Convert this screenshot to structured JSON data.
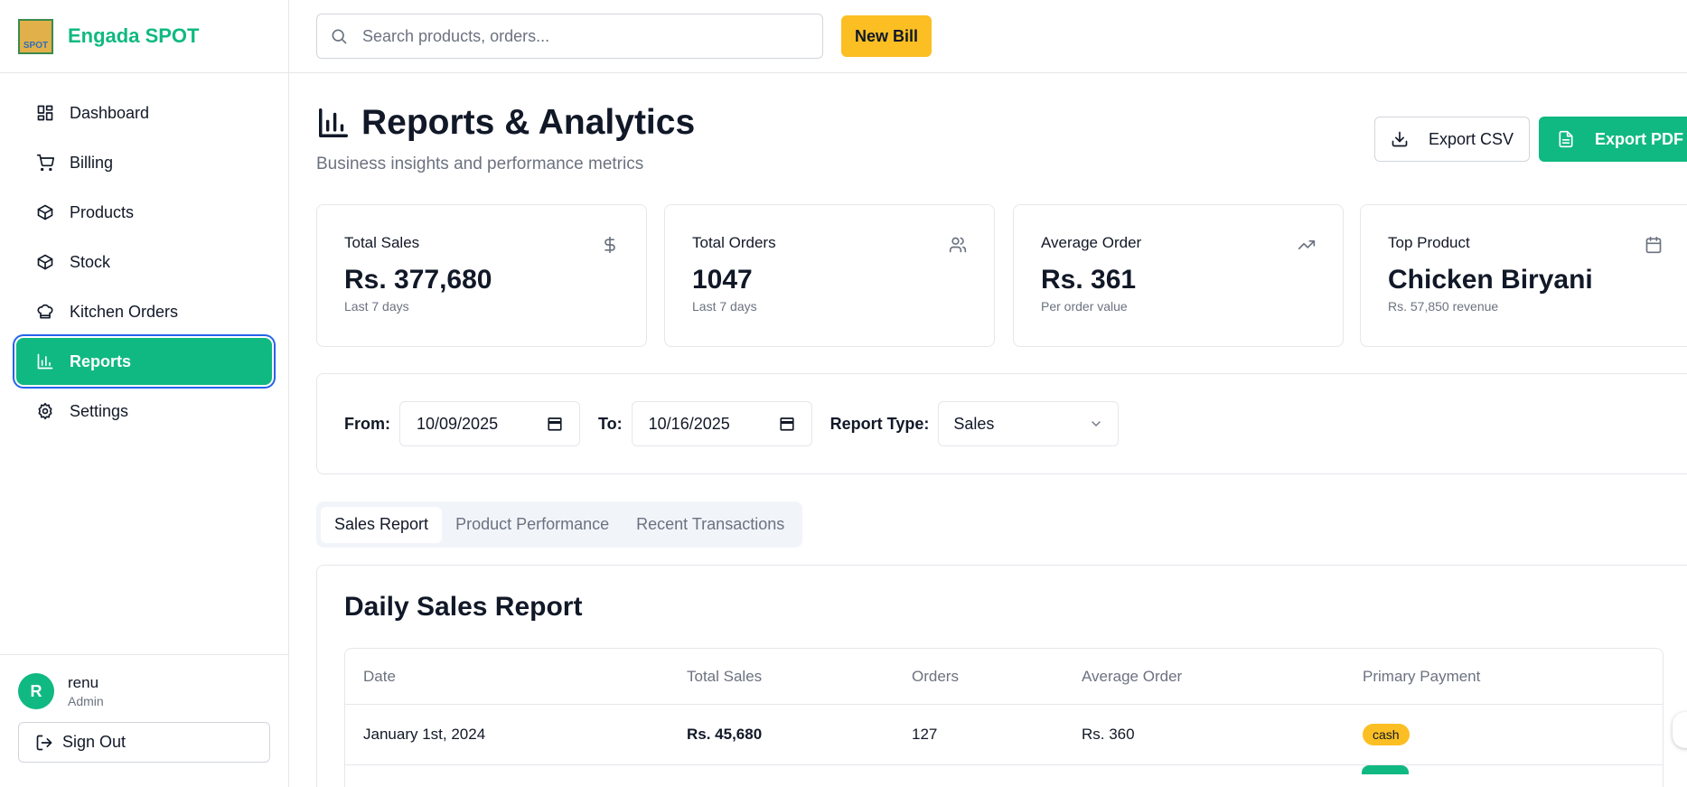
{
  "app": {
    "name": "Engada SPOT",
    "logo_text": "SPOT"
  },
  "sidebar": {
    "items": [
      {
        "label": "Dashboard",
        "icon": "grid-icon"
      },
      {
        "label": "Billing",
        "icon": "cart-icon"
      },
      {
        "label": "Products",
        "icon": "package-icon"
      },
      {
        "label": "Stock",
        "icon": "package-icon"
      },
      {
        "label": "Kitchen Orders",
        "icon": "chef-hat-icon"
      },
      {
        "label": "Reports",
        "icon": "bar-chart-icon",
        "active": true
      },
      {
        "label": "Settings",
        "icon": "gear-icon"
      }
    ]
  },
  "user": {
    "initial": "R",
    "name": "renu",
    "role": "Admin",
    "sign_out": "Sign Out"
  },
  "topbar": {
    "search_placeholder": "Search products, orders...",
    "new_bill": "New Bill"
  },
  "page": {
    "title": "Reports & Analytics",
    "subtitle": "Business insights and performance metrics",
    "export_csv": "Export CSV",
    "export_pdf": "Export PDF"
  },
  "stats": [
    {
      "label": "Total Sales",
      "value": "Rs. 377,680",
      "note": "Last 7 days",
      "icon": "dollar-icon"
    },
    {
      "label": "Total Orders",
      "value": "1047",
      "note": "Last 7 days",
      "icon": "users-icon"
    },
    {
      "label": "Average Order",
      "value": "Rs. 361",
      "note": "Per order value",
      "icon": "trending-up-icon"
    },
    {
      "label": "Top Product",
      "value": "Chicken Biryani",
      "note": "Rs. 57,850 revenue",
      "icon": "calendar-icon"
    }
  ],
  "filters": {
    "from_label": "From:",
    "from_value": "10/09/2025",
    "to_label": "To:",
    "to_value": "10/16/2025",
    "type_label": "Report Type:",
    "type_value": "Sales"
  },
  "tabs": [
    {
      "label": "Sales Report",
      "active": true
    },
    {
      "label": "Product Performance"
    },
    {
      "label": "Recent Transactions"
    }
  ],
  "report": {
    "title": "Daily Sales Report",
    "columns": [
      "Date",
      "Total Sales",
      "Orders",
      "Average Order",
      "Primary Payment"
    ],
    "rows": [
      {
        "date": "January 1st, 2024",
        "total": "Rs. 45,680",
        "orders": "127",
        "avg": "Rs. 360",
        "payment": "cash"
      }
    ]
  },
  "colors": {
    "brand": "#10b981",
    "accent": "#fbbf24",
    "focus_ring": "#2563eb"
  }
}
